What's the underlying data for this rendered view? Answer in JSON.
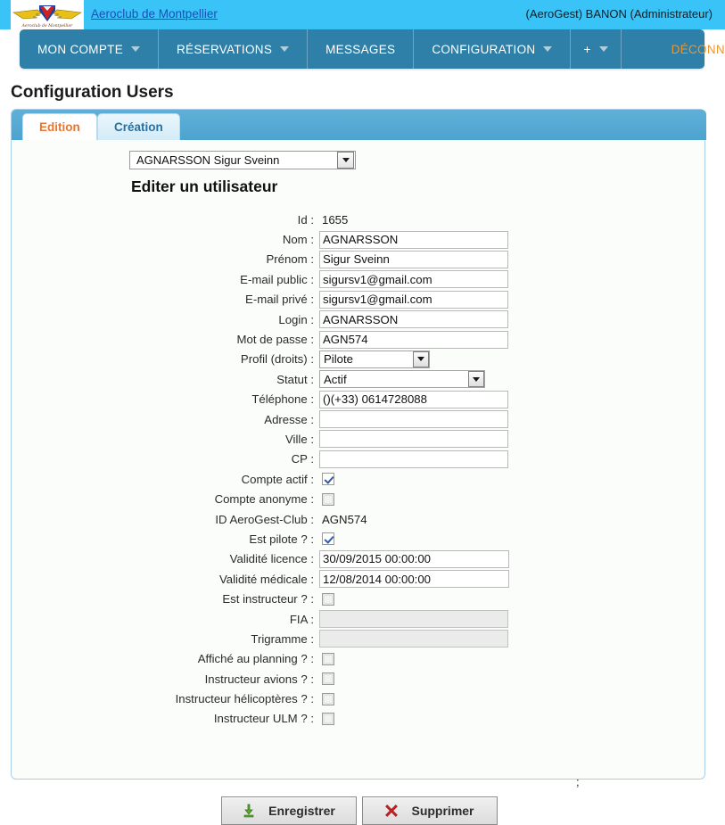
{
  "header": {
    "club_link": "Aeroclub de Montpellier",
    "logo_alt": "Aeroclub de Montpellier",
    "user_info": "(AeroGest) BANON (Administrateur)"
  },
  "nav": {
    "items": [
      {
        "label": "MON COMPTE",
        "has_caret": true
      },
      {
        "label": "RÉSERVATIONS",
        "has_caret": true
      },
      {
        "label": "MESSAGES",
        "has_caret": false
      },
      {
        "label": "CONFIGURATION",
        "has_caret": true
      },
      {
        "label": "+",
        "has_caret": true
      }
    ],
    "logout": "DÉCONNEXION"
  },
  "page": {
    "title": "Configuration Users"
  },
  "tabs": [
    {
      "label": "Edition",
      "active": true
    },
    {
      "label": "Création",
      "active": false
    }
  ],
  "form": {
    "user_selector": {
      "value": "AGNARSSON Sigur Sveinn"
    },
    "heading": "Editer un utilisateur",
    "fields": [
      {
        "label": "Id :",
        "type": "static",
        "value": "1655"
      },
      {
        "label": "Nom :",
        "type": "text",
        "value": "AGNARSSON"
      },
      {
        "label": "Prénom :",
        "type": "text",
        "value": "Sigur Sveinn"
      },
      {
        "label": "E-mail public :",
        "type": "text",
        "value": "sigursv1@gmail.com"
      },
      {
        "label": "E-mail privé :",
        "type": "text",
        "value": "sigursv1@gmail.com"
      },
      {
        "label": "Login :",
        "type": "text",
        "value": "AGNARSSON"
      },
      {
        "label": "Mot de passe :",
        "type": "text",
        "value": "AGN574"
      },
      {
        "label": "Profil (droits) :",
        "type": "select-profil",
        "value": "Pilote"
      },
      {
        "label": "Statut :",
        "type": "select-statut",
        "value": "Actif"
      },
      {
        "label": "Téléphone :",
        "type": "text",
        "value": "()(+33) 0614728088"
      },
      {
        "label": "Adresse :",
        "type": "text",
        "value": ""
      },
      {
        "label": "Ville :",
        "type": "text",
        "value": ""
      },
      {
        "label": "CP :",
        "type": "text",
        "value": ""
      },
      {
        "label": "Compte actif :",
        "type": "checkbox",
        "checked": true
      },
      {
        "label": "Compte anonyme :",
        "type": "checkbox",
        "checked": false
      },
      {
        "label": "ID AeroGest-Club :",
        "type": "static",
        "value": "AGN574"
      },
      {
        "label": "Est pilote ? :",
        "type": "checkbox",
        "checked": true
      },
      {
        "label": "Validité licence :",
        "type": "text-date",
        "value": "30/09/2015 00:00:00"
      },
      {
        "label": "Validité médicale :",
        "type": "text-date",
        "value": "12/08/2014 00:00:00"
      },
      {
        "label": "Est instructeur ? :",
        "type": "checkbox",
        "checked": false
      },
      {
        "label": "FIA :",
        "type": "text-disabled",
        "value": ""
      },
      {
        "label": "Trigramme :",
        "type": "text-disabled",
        "value": ""
      },
      {
        "label": "Affiché au planning ? :",
        "type": "checkbox",
        "checked": false
      },
      {
        "label": "Instructeur avions ? :",
        "type": "checkbox",
        "checked": false
      },
      {
        "label": "Instructeur hélicoptères ? :",
        "type": "checkbox",
        "checked": false
      },
      {
        "label": "Instructeur ULM ? :",
        "type": "checkbox",
        "checked": false
      }
    ],
    "stray_text": ";",
    "buttons": [
      {
        "label": "Enregistrer",
        "icon": "save-download-icon"
      },
      {
        "label": "Supprimer",
        "icon": "delete-cross-icon"
      }
    ]
  },
  "colors": {
    "topbar": "#3ac3f7",
    "navbar": "#2e80a8",
    "logout_text": "#f0952a",
    "active_tab_text": "#e8762d",
    "inactive_tab_text": "#2a6f9e",
    "panel_border": "#a9cfe8",
    "link": "#1a4fb8"
  }
}
